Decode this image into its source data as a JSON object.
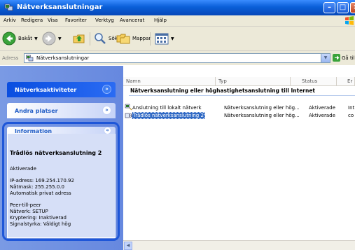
{
  "window": {
    "title": "Nätverksanslutningar"
  },
  "menubar": {
    "items": [
      "Arkiv",
      "Redigera",
      "Visa",
      "Favoriter",
      "Verktyg",
      "Avancerat",
      "Hjälp"
    ]
  },
  "toolbar": {
    "back_label": "Bakåt",
    "search_label": "Sök",
    "folders_label": "Mappar"
  },
  "address": {
    "label": "Adress",
    "value": "Nätverksanslutningar",
    "go_label": "Gå till"
  },
  "taskpane": {
    "network_tasks_title": "Nätverksaktiviteter",
    "other_places_title": "Andra platser",
    "information": {
      "title": "Information",
      "connection_name": "Trådlös nätverksanslutning 2",
      "status": "Aktiverade",
      "ip": "IP-adress: 169.254.170.92",
      "mask": "Nätmask: 255.255.0.0",
      "assignment": "Automatisk privat adress",
      "mode": "Peer-till-peer",
      "network": "Nätverk: SETUP",
      "encryption": "Kryptering: Inaktiverad",
      "signal": "Signalstyrka: Väldigt hög"
    }
  },
  "list": {
    "columns": {
      "name": "Namn",
      "type": "Typ",
      "status": "Status",
      "extra": "Er"
    },
    "group_title": "Nätverksanslutning eller höghastighetsanslutning till Internet",
    "rows": [
      {
        "name": "Anslutning till lokalt nätverk",
        "type": "Nätverksanslutning eller hög...",
        "status": "Aktiverade",
        "extra": "Int"
      },
      {
        "name": "Trådlös nätverksanslutning 2",
        "type": "Nätverksanslutning eller hög...",
        "status": "Aktiverade",
        "extra": "co"
      }
    ]
  },
  "colors": {
    "title_bar": "#0a5fd8",
    "taskpane": "#6f8fe1",
    "selection": "#316ac5",
    "highlight_ring": "#1e56d8"
  }
}
